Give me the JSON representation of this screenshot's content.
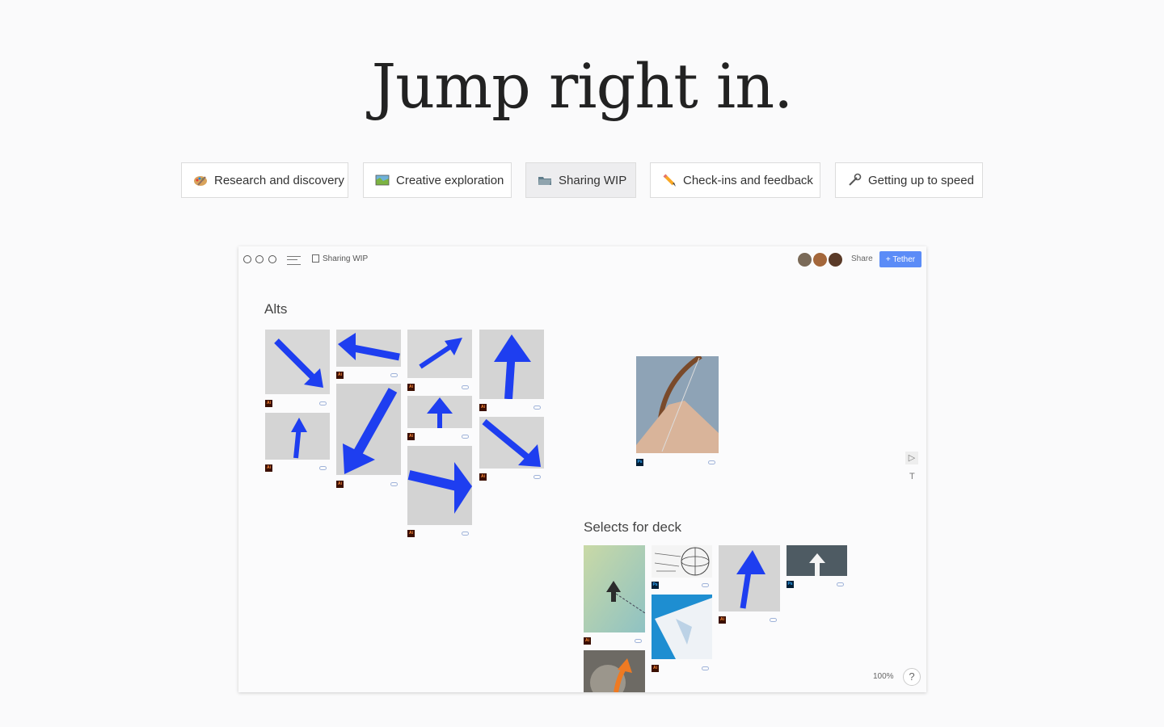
{
  "hero": {
    "title": "Jump right in."
  },
  "tabs": [
    {
      "label": "Research and discovery",
      "icon": "palette-icon"
    },
    {
      "label": "Creative exploration",
      "icon": "map-icon"
    },
    {
      "label": "Sharing WIP",
      "icon": "folder-icon",
      "active": true
    },
    {
      "label": "Check-ins and feedback",
      "icon": "pencil-icon"
    },
    {
      "label": "Getting up to speed",
      "icon": "wrench-icon"
    }
  ],
  "board": {
    "title": "Sharing WIP",
    "share_label": "Share",
    "tether_label": "+ Tether",
    "sections": {
      "alts": "Alts",
      "selects": "Selects for deck"
    },
    "badges": {
      "ai": "Ai",
      "ps": "Ps"
    },
    "tools": {
      "select": "▷",
      "text": "T"
    },
    "zoom": "100%",
    "help": "?"
  },
  "colors": {
    "accent": "#5b8cf7",
    "arrow_blue": "#1e3ef0",
    "active_tab": "#ededef"
  }
}
